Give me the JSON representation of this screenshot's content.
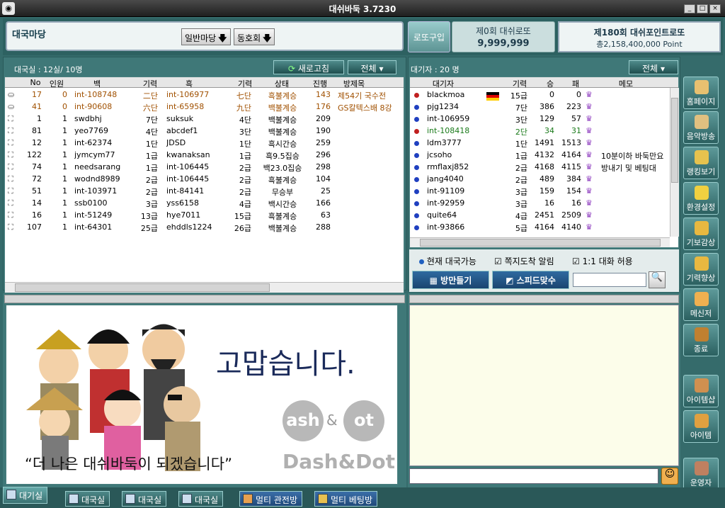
{
  "window": {
    "title": "대쉬바둑 3.7230",
    "app_icon": "game-icon"
  },
  "header": {
    "lobby_title": "대국마당",
    "select1": "일반마당",
    "select2": "동호회",
    "lotto_button": "로또구입",
    "lotto_round": "제0회 대쉬로또",
    "lotto_amount": "9,999,999",
    "point_round": "제180회 대쉬포인트로또",
    "point_total": "총2,158,400,000 Point"
  },
  "rooms": {
    "summary": "대국실 : 12실/ 10명",
    "refresh": "새로고침",
    "filter": "전체",
    "columns": [
      "No",
      "인원",
      "백",
      "기력",
      "흑",
      "기력",
      "상태",
      "진행",
      "방제목"
    ],
    "rows": [
      {
        "no": "17",
        "cnt": "0",
        "white": "int-108748",
        "wr": "二단",
        "black": "int-106977",
        "br": "七단",
        "state": "흑불계승",
        "moves": "143",
        "title": "제54기 국수전 ",
        "hl": true
      },
      {
        "no": "41",
        "cnt": "0",
        "white": "int-90608",
        "wr": "六단",
        "black": "int-65958",
        "br": "九단",
        "state": "백불계승",
        "moves": "176",
        "title": "GS칼텍스배 8강",
        "hl": true
      },
      {
        "no": "1",
        "cnt": "1",
        "white": "swdbhj",
        "wr": "7단",
        "black": "suksuk",
        "br": "4단",
        "state": "백불계승",
        "moves": "209",
        "title": "",
        "hl": false
      },
      {
        "no": "81",
        "cnt": "1",
        "white": "yeo7769",
        "wr": "4단",
        "black": "abcdef1",
        "br": "3단",
        "state": "백불계승",
        "moves": "190",
        "title": "",
        "hl": false
      },
      {
        "no": "12",
        "cnt": "1",
        "white": "int-62374",
        "wr": "1단",
        "black": "JDSD",
        "br": "1단",
        "state": "흑시간승",
        "moves": "259",
        "title": "",
        "hl": false
      },
      {
        "no": "122",
        "cnt": "1",
        "white": "jymcym77",
        "wr": "1급",
        "black": "kwanaksan",
        "br": "1급",
        "state": "흑9.5집승",
        "moves": "296",
        "title": "",
        "hl": false
      },
      {
        "no": "74",
        "cnt": "1",
        "white": "needsarang",
        "wr": "1급",
        "black": "int-106445",
        "br": "2급",
        "state": "백23.0집승",
        "moves": "298",
        "title": "",
        "hl": false
      },
      {
        "no": "72",
        "cnt": "1",
        "white": "wodnd8989",
        "wr": "2급",
        "black": "int-106445",
        "br": "2급",
        "state": "흑불계승",
        "moves": "104",
        "title": "",
        "hl": false
      },
      {
        "no": "51",
        "cnt": "1",
        "white": "int-103971",
        "wr": "2급",
        "black": "int-84141",
        "br": "2급",
        "state": "무승부",
        "moves": "25",
        "title": "",
        "hl": false
      },
      {
        "no": "14",
        "cnt": "1",
        "white": "ssb0100",
        "wr": "3급",
        "black": "yss6158",
        "br": "4급",
        "state": "백시간승",
        "moves": "166",
        "title": "",
        "hl": false
      },
      {
        "no": "16",
        "cnt": "1",
        "white": "int-51249",
        "wr": "13급",
        "black": "hye7011",
        "br": "15급",
        "state": "흑불계승",
        "moves": "63",
        "title": "",
        "hl": false
      },
      {
        "no": "107",
        "cnt": "1",
        "white": "int-64301",
        "wr": "25급",
        "black": "ehddls1224",
        "br": "26급",
        "state": "백불계승",
        "moves": "288",
        "title": "",
        "hl": false
      }
    ]
  },
  "waiting": {
    "summary": "대기자 : 20 명",
    "filter": "전체",
    "columns": [
      "대기자",
      "기력",
      "승",
      "패",
      "메모"
    ],
    "rows": [
      {
        "name": "blackmoa",
        "rank": "15급",
        "win": "0",
        "loss": "0",
        "memo": "",
        "flag": true,
        "mark": "red",
        "hl": false
      },
      {
        "name": "pjg1234",
        "rank": "7단",
        "win": "386",
        "loss": "223",
        "memo": "",
        "flag": false,
        "mark": "blue",
        "hl": false
      },
      {
        "name": "int-106959",
        "rank": "3단",
        "win": "129",
        "loss": "57",
        "memo": "",
        "flag": false,
        "mark": "blue",
        "hl": false
      },
      {
        "name": "int-108418",
        "rank": "2단",
        "win": "34",
        "loss": "31",
        "memo": "",
        "flag": false,
        "mark": "red",
        "hl": true
      },
      {
        "name": "ldm3777",
        "rank": "1단",
        "win": "1491",
        "loss": "1513",
        "memo": "",
        "flag": false,
        "mark": "blue",
        "hl": false
      },
      {
        "name": "jcsoho",
        "rank": "1급",
        "win": "4132",
        "loss": "4164",
        "memo": "10분이하 바둑만요",
        "flag": false,
        "mark": "blue",
        "hl": false
      },
      {
        "name": "rmflaxj852",
        "rank": "2급",
        "win": "4168",
        "loss": "4115",
        "memo": "방내기 및 베팅대",
        "flag": false,
        "mark": "blue",
        "hl": false
      },
      {
        "name": "jang4040",
        "rank": "2급",
        "win": "489",
        "loss": "384",
        "memo": "",
        "flag": false,
        "mark": "blue",
        "hl": false
      },
      {
        "name": "int-91109",
        "rank": "3급",
        "win": "159",
        "loss": "154",
        "memo": "",
        "flag": false,
        "mark": "blue",
        "hl": false
      },
      {
        "name": "int-92959",
        "rank": "3급",
        "win": "16",
        "loss": "16",
        "memo": "",
        "flag": false,
        "mark": "blue",
        "hl": false
      },
      {
        "name": "quite64",
        "rank": "4급",
        "win": "2451",
        "loss": "2509",
        "memo": "",
        "flag": false,
        "mark": "blue",
        "hl": false
      },
      {
        "name": "int-93866",
        "rank": "5급",
        "win": "4164",
        "loss": "4140",
        "memo": "",
        "flag": false,
        "mark": "blue",
        "hl": false
      }
    ]
  },
  "options": {
    "current_game": "현재 대국가능",
    "note_alert": "쪽지도착 알림",
    "chat_allow": "1:1 대화 허용",
    "make_room": "방만들기",
    "speed_match": "스피드맞수"
  },
  "banner": {
    "thanks": "고맙습니다.",
    "slogan": "“더 나은 대쉬바둑이 되겠습니다”",
    "logo_ash": "ash",
    "logo_amp": "&",
    "logo_ot": "ot",
    "brand": "Dash&Dot"
  },
  "sidebar": [
    {
      "label": "홈페이지",
      "icon": "home-icon",
      "color": "#e8c070"
    },
    {
      "label": "음악방송",
      "icon": "music-icon",
      "color": "#e0c080"
    },
    {
      "label": "랭킹보기",
      "icon": "trophy-icon",
      "color": "#e6c24e"
    },
    {
      "label": "환경설정",
      "icon": "settings-icon",
      "color": "#f0d040"
    },
    {
      "label": "기보감상",
      "icon": "board-icon",
      "color": "#e8b840"
    },
    {
      "label": "기력향상",
      "icon": "grid-icon",
      "color": "#e8b840"
    },
    {
      "label": "메신저",
      "icon": "messenger-icon",
      "color": "#f0b050"
    },
    {
      "label": "종료",
      "icon": "exit-icon",
      "color": "#c08030"
    },
    {
      "label": "아이템샵",
      "icon": "shop-icon",
      "color": "#d09050"
    },
    {
      "label": "아이템",
      "icon": "item-box-icon",
      "color": "#e0a040"
    },
    {
      "label": "운영자",
      "icon": "operator-icon",
      "color": "#c08060"
    }
  ],
  "tabs": {
    "waiting_room": "대기실",
    "game1": "대국실",
    "game2": "대국실",
    "game3": "대국실",
    "multi_watch": "멀티 관전방",
    "multi_bet": "멀티 베팅방"
  }
}
